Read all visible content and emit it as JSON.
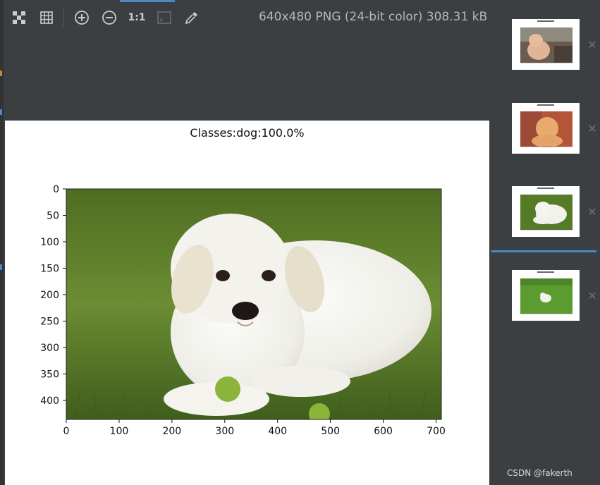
{
  "toolbar": {
    "buttons": [
      "chessboard-icon",
      "grid-icon",
      "zoom-in-icon",
      "zoom-out-icon",
      "actual-size-label",
      "fit-window-icon",
      "color-picker-icon"
    ],
    "actual_size_label": "1:1",
    "image_info": "640x480 PNG (24-bit color) 308.31 kB"
  },
  "figure": {
    "title": "Classes:dog:100.0%",
    "x_ticks": [
      "0",
      "100",
      "200",
      "300",
      "400",
      "500",
      "600",
      "700"
    ],
    "y_ticks": [
      "0",
      "50",
      "100",
      "150",
      "200",
      "250",
      "300",
      "350",
      "400"
    ],
    "x_range": [
      0,
      710
    ],
    "y_range": [
      0,
      436
    ]
  },
  "thumbnails": [
    {
      "name": "kitten-on-deck",
      "selected": false
    },
    {
      "name": "kitten-red-background",
      "selected": false
    },
    {
      "name": "white-puppy-on-grass",
      "selected": true
    },
    {
      "name": "puppy-on-lawn",
      "selected": false
    }
  ],
  "colors": {
    "background": "#3c3f41",
    "accent": "#4a88c7",
    "grass": "#5a7d2a"
  },
  "watermark": "CSDN @fakerth"
}
